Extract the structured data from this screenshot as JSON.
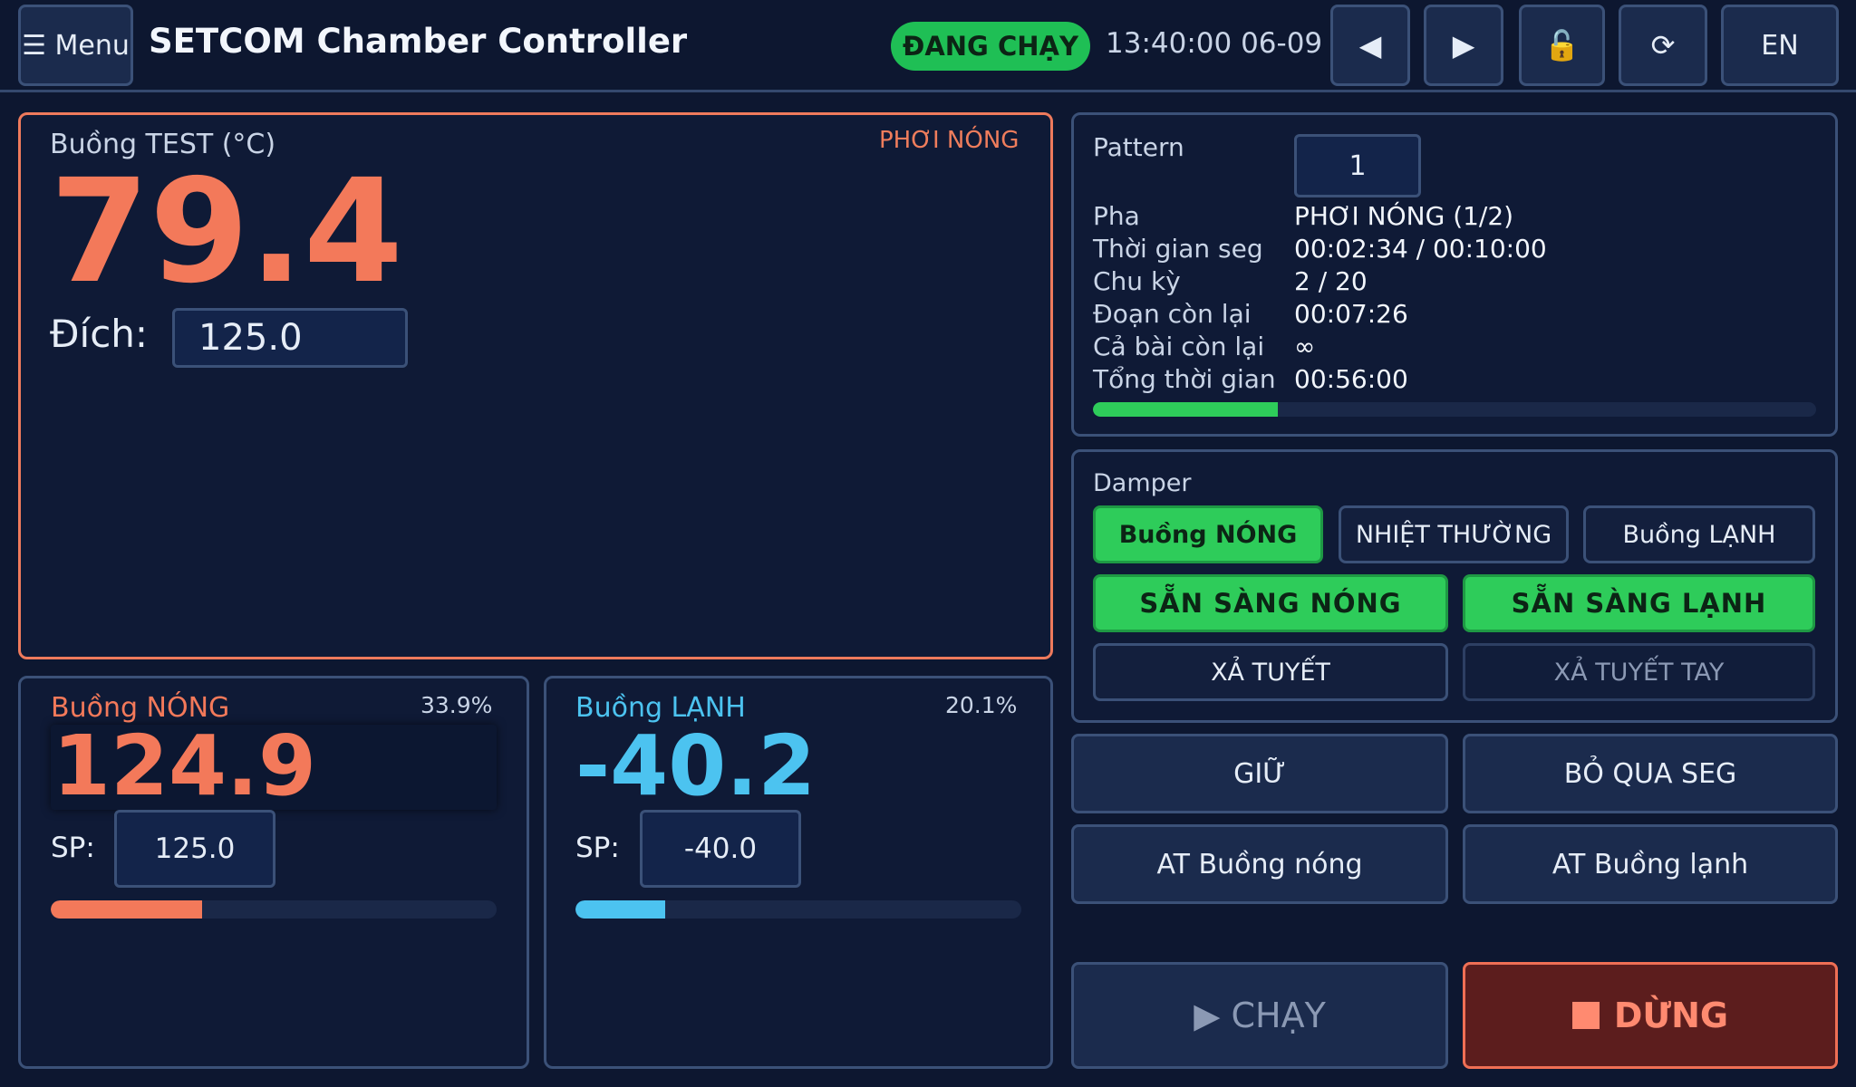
{
  "header": {
    "menu_label": "☰ Menu",
    "title": "SETCOM Chamber Controller",
    "status": "ĐANG CHẠY",
    "clock": "13:40:00 06-09",
    "prev_icon": "◀",
    "next_icon": "▶",
    "lock_icon": "🔓",
    "refresh_icon": "⟳",
    "lang": "EN"
  },
  "test_chamber": {
    "label": "Buồng TEST (°C)",
    "phase": "PHƠI NÓNG",
    "value": "79.4",
    "target_label": "Đích:",
    "target_value": "125.0"
  },
  "hot_chamber": {
    "name": "Buồng NÓNG",
    "percent": "33.9%",
    "percent_fraction": 0.339,
    "value": "124.9",
    "sp_label": "SP:",
    "sp_value": "125.0"
  },
  "cold_chamber": {
    "name": "Buồng LẠNH",
    "percent": "20.1%",
    "percent_fraction": 0.201,
    "value": "-40.2",
    "sp_label": "SP:",
    "sp_value": "-40.0"
  },
  "pattern": {
    "label": "Pattern",
    "value": "1",
    "rows": [
      {
        "key": "Pha",
        "value": "PHƠI NÓNG (1/2)"
      },
      {
        "key": "Thời gian seg",
        "value": "00:02:34 / 00:10:00"
      },
      {
        "key": "Chu kỳ",
        "value": "2 / 20"
      },
      {
        "key": "Đoạn còn lại",
        "value": "00:07:26"
      },
      {
        "key": "Cả bài còn lại",
        "value": "∞"
      },
      {
        "key": "Tổng thời gian",
        "value": "00:56:00"
      }
    ],
    "progress_fraction": 0.256
  },
  "damper": {
    "label": "Damper",
    "hot": "Buồng NÓNG",
    "normal": "NHIỆT THƯỜNG",
    "cold": "Buồng LẠNH",
    "ready_hot": "SẴN SÀNG NÓNG",
    "ready_cold": "SẴN SÀNG LẠNH",
    "defrost": "XẢ TUYẾT",
    "defrost_manual": "XẢ TUYẾT TAY"
  },
  "actions": {
    "hold": "GIỮ",
    "skip": "BỎ QUA SEG",
    "at_hot": "AT Buồng nóng",
    "at_cold": "AT Buồng lạnh",
    "run": "▶ CHẠY",
    "stop": "DỪNG"
  },
  "colors": {
    "hot": "#f3795a",
    "cold": "#4cc3f0",
    "green": "#2ecc5a"
  }
}
